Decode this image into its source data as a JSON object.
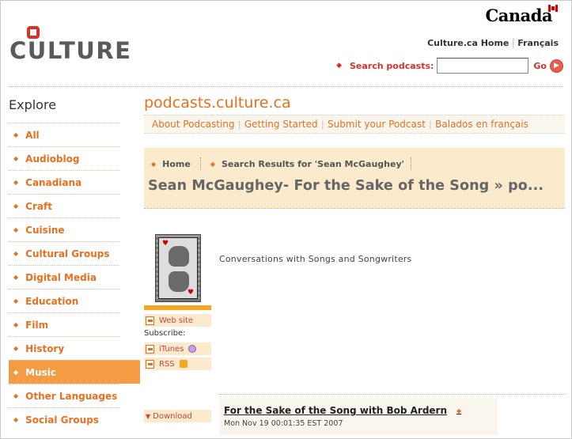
{
  "header": {
    "canada_wordmark": "Canada",
    "logo_text": "CULTURE",
    "toplinks": [
      "Culture.ca Home",
      "Français"
    ],
    "search": {
      "label": "Search podcasts:",
      "value": "",
      "go_label": "Go"
    }
  },
  "sidebar": {
    "title": "Explore",
    "items": [
      {
        "label": "All",
        "active": false
      },
      {
        "label": "Audioblog",
        "active": false
      },
      {
        "label": "Canadiana",
        "active": false
      },
      {
        "label": "Craft",
        "active": false
      },
      {
        "label": "Cuisine",
        "active": false
      },
      {
        "label": "Cultural Groups",
        "active": false
      },
      {
        "label": "Digital Media",
        "active": false
      },
      {
        "label": "Education",
        "active": false
      },
      {
        "label": "Film",
        "active": false
      },
      {
        "label": "History",
        "active": false
      },
      {
        "label": "Music",
        "active": true
      },
      {
        "label": "Other Languages",
        "active": false
      },
      {
        "label": "Social Groups",
        "active": false
      }
    ]
  },
  "main": {
    "site_title": "podcasts.culture.ca",
    "subnav": [
      "About Podcasting",
      "Getting Started",
      "Submit your Podcast",
      "Balados en français"
    ],
    "breadcrumbs": [
      "Home",
      "Search Results for 'Sean McGaughey'"
    ],
    "page_heading": "Sean McGaughey- For the Sake of the Song » po...",
    "podcast": {
      "description": "Conversations with Songs and Songwriters",
      "website_label": "Web site",
      "subscribe_label": "Subscribe:",
      "itunes_label": "iTunes",
      "rss_label": "RSS"
    },
    "episode": {
      "download_label": "Download",
      "title": "For the Sake of the Song with Bob Ardern",
      "date": "Mon Nov 19 00:01:35 EST 2007"
    }
  },
  "colors": {
    "accent_orange": "#e8701e",
    "active_nav_bg": "#f49b44",
    "brand_red": "#d9302a",
    "crumb_bg": "#fbeacb"
  }
}
